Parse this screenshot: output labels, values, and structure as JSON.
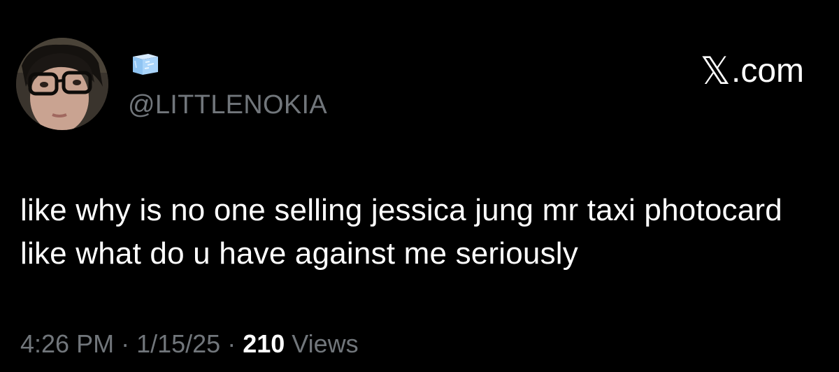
{
  "author": {
    "handle": "@LITTLENOKIA",
    "name_icon": "ice-cube-icon",
    "avatar": "profile-photo"
  },
  "brand": {
    "mark": "𝕏",
    "domain": ".com"
  },
  "post": {
    "text": "like why is no one selling jessica jung mr taxi photocard like what do u have against me seriously"
  },
  "meta": {
    "time": "4:26 PM",
    "separator": " · ",
    "date": "1/15/25",
    "views_count": "210",
    "views_label": " Views"
  },
  "colors": {
    "background": "#000000",
    "text": "#ffffff",
    "muted": "#71767b"
  }
}
